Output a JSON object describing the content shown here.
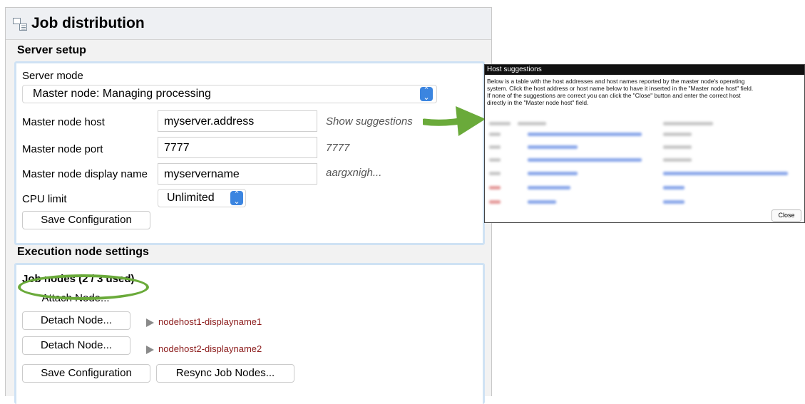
{
  "window": {
    "title": "Job distribution",
    "title_icon": "job-distribution-icon"
  },
  "server_setup": {
    "heading": "Server setup",
    "server_mode_label": "Server mode",
    "server_mode_value": "Master node: Managing processing",
    "master_host_label": "Master node host",
    "master_host_value": "myserver.address",
    "master_host_hint": "Show suggestions",
    "master_port_label": "Master node port",
    "master_port_value": "7777",
    "master_port_hint": "7777",
    "display_name_label": "Master node display name",
    "display_name_value": "myservername",
    "display_name_hint": "aargxnigh...",
    "cpu_limit_label": "CPU limit",
    "cpu_limit_value": "Unlimited",
    "save_button": "Save Configuration"
  },
  "execution": {
    "heading": "Execution node settings",
    "job_nodes_label": "Job nodes (2 / 3 used)",
    "attach_button": "Attach Node...",
    "nodes": [
      {
        "detach_button": "Detach Node...",
        "name": "nodehost1-displayname1"
      },
      {
        "detach_button": "Detach Node...",
        "name": "nodehost2-displayname2"
      }
    ],
    "save_button": "Save Configuration",
    "resync_button": "Resync Job Nodes..."
  },
  "popup": {
    "title": "Host suggestions",
    "description_1": "Below is a table with the host addresses and host names reported by the master node's operating",
    "description_2": "system. Click the host address or host name below to have it inserted in the \"Master node host\" field.",
    "description_3": "If none of the suggestions are correct you can click the \"Close\" button and enter the correct host",
    "description_4": "directly in the \"Master node host\" field.",
    "close_button": "Close"
  },
  "colors": {
    "accent_blue": "#3b85e0",
    "annotation_green": "#6aaa3a",
    "node_name": "#8b1a1a",
    "box_border": "#cfe2f4"
  }
}
